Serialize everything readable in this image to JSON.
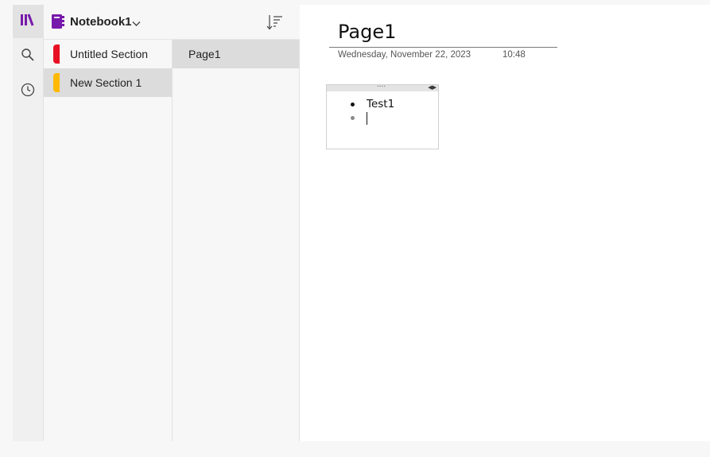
{
  "notebook": {
    "title": "Notebook1"
  },
  "rail": {
    "items": [
      {
        "icon": "notebooks-icon"
      },
      {
        "icon": "search-icon"
      },
      {
        "icon": "recent-clock-icon"
      }
    ]
  },
  "sections": [
    {
      "label": "Untitled Section",
      "color": "#e81123",
      "selected": false
    },
    {
      "label": "New Section 1",
      "color": "#ffb900",
      "selected": true
    }
  ],
  "pages": [
    {
      "label": "Page1",
      "selected": true
    }
  ],
  "page": {
    "title": "Page1",
    "date": "Wednesday, November 22, 2023",
    "time": "10:48",
    "note": {
      "items": [
        "Test1",
        ""
      ]
    }
  },
  "colors": {
    "brand": "#7719aa"
  }
}
